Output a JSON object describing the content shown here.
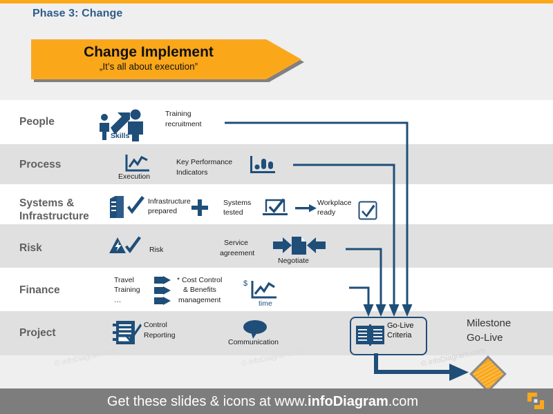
{
  "slide": {
    "phase_title": "Phase 3: Change",
    "banner": {
      "title": "Change Implement",
      "subtitle": "„It’s all about execution”"
    },
    "accent_orange": "#FAA719",
    "accent_navy": "#1F4E79",
    "row_label_gray": "#606060"
  },
  "rows": [
    {
      "label": "People",
      "items": [
        {
          "icon": "people-skills-icon",
          "caption": "Skills"
        },
        {
          "icon": "",
          "caption": "Training\nrecruitment"
        }
      ]
    },
    {
      "label": "Process",
      "items": [
        {
          "icon": "line-chart-icon",
          "caption": "Execution"
        },
        {
          "icon": "",
          "caption": "Key Performance\nIndicators"
        },
        {
          "icon": "bar-chart-icon",
          "caption": ""
        }
      ]
    },
    {
      "label": "Systems &\nInfrastructure",
      "items": [
        {
          "icon": "server-check-icon",
          "caption": "Infrastructure\nprepared"
        },
        {
          "icon": "plus-icon",
          "caption": ""
        },
        {
          "icon": "laptop-check-icon",
          "caption": "Systems\ntested"
        },
        {
          "icon": "arrow-right-icon",
          "caption": ""
        },
        {
          "icon": "checkbox-icon",
          "caption": "Workplace\nready"
        }
      ]
    },
    {
      "label": "Risk",
      "items": [
        {
          "icon": "risk-check-icon",
          "caption": "Risk"
        },
        {
          "icon": "negotiate-icon",
          "caption": "Service\nagreement"
        },
        {
          "icon": "",
          "caption": "Negotiate"
        }
      ]
    },
    {
      "label": "Finance",
      "items": [
        {
          "icon": "",
          "caption": "Travel\nTraining\n…"
        },
        {
          "icon": "triple-arrow-icon",
          "caption": ""
        },
        {
          "icon": "",
          "caption": "* Cost Control\n& Benefits\nmanagement"
        },
        {
          "icon": "dollar-time-chart-icon",
          "caption": "time"
        }
      ]
    },
    {
      "label": "Project",
      "items": [
        {
          "icon": "checklist-icon",
          "caption": "Control\nReporting"
        },
        {
          "icon": "speech-bubble-icon",
          "caption": "Communication"
        }
      ]
    }
  ],
  "row_texts": {
    "people_label": "People",
    "people_skills": "Skills",
    "people_training": "Training",
    "people_recruitment": "recruitment",
    "process_label": "Process",
    "process_execution": "Execution",
    "process_kpi_1": "Key Performance",
    "process_kpi_2": "Indicators",
    "systems_label_1": "Systems &",
    "systems_label_2": "Infrastructure",
    "systems_infra_1": "Infrastructure",
    "systems_infra_2": "prepared",
    "systems_tested_1": "Systems",
    "systems_tested_2": "tested",
    "systems_ready_1": "Workplace",
    "systems_ready_2": "ready",
    "risk_label": "Risk",
    "risk_caption": "Risk",
    "risk_service_1": "Service",
    "risk_service_2": "agreement",
    "risk_negotiate": "Negotiate",
    "finance_label": "Finance",
    "finance_travel": "Travel",
    "finance_training": "Training",
    "finance_dots": "…",
    "finance_cost_1": "* Cost Control",
    "finance_cost_2": "& Benefits",
    "finance_cost_3": "management",
    "finance_dollar": "$",
    "finance_time": "time",
    "project_label": "Project",
    "project_control": "Control",
    "project_reporting": "Reporting",
    "project_communication": "Communication"
  },
  "golive": {
    "line1": "Go-Live",
    "line2": "Criteria"
  },
  "milestone": {
    "line1": "Milestone",
    "line2": "Go-Live"
  },
  "watermark": {
    "text": "© infoDiagram.com"
  },
  "footer": {
    "prefix": "Get these slides & icons at www.",
    "brand": "infoDiagram",
    "suffix": ".com"
  }
}
